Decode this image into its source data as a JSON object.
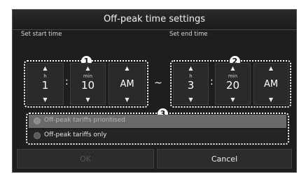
{
  "dialog": {
    "title": "Off-peak time settings",
    "start_label": "Set start time",
    "end_label": "Set end time",
    "start": {
      "hour_unit": "h",
      "hour": "1",
      "min_unit": "min",
      "minute": "10",
      "ampm": "AM"
    },
    "end": {
      "hour_unit": "h",
      "hour": "3",
      "min_unit": "min",
      "minute": "20",
      "ampm": "AM"
    },
    "colon": ":",
    "tilde": "~",
    "badges": [
      "1",
      "2",
      "3"
    ],
    "options": [
      {
        "label": "Off-peak tariffs prioritised",
        "selected": true,
        "disabled": true
      },
      {
        "label": "Off-peak tariffs only",
        "selected": false,
        "disabled": false
      }
    ],
    "buttons": {
      "ok": "OK",
      "cancel": "Cancel"
    }
  }
}
